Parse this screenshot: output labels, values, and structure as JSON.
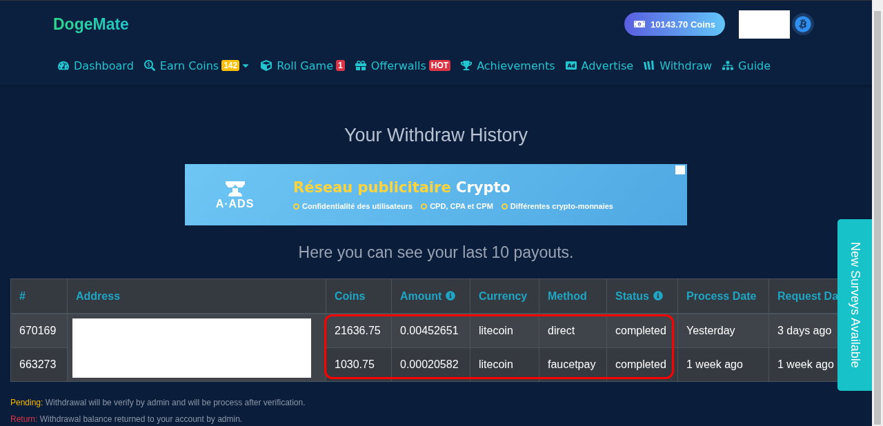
{
  "brand": "DogeMate",
  "balance": "10143.70 Coins",
  "nav": [
    {
      "kind": "dashboard",
      "label": "Dashboard"
    },
    {
      "kind": "earn",
      "label": "Earn Coins",
      "badge": {
        "text": "142",
        "color": "#ffc107"
      },
      "dropdown": true
    },
    {
      "kind": "roll",
      "label": "Roll Game",
      "badge": {
        "text": "1",
        "color": "#dc3545"
      }
    },
    {
      "kind": "offerwalls",
      "label": "Offerwalls",
      "badge": {
        "text": "HOT",
        "color": "#dc3545"
      }
    },
    {
      "kind": "achievements",
      "label": "Achievements"
    },
    {
      "kind": "advertise",
      "label": "Advertise"
    },
    {
      "kind": "withdraw",
      "label": "Withdraw"
    },
    {
      "kind": "guide",
      "label": "Guide"
    }
  ],
  "page_title": "Your Withdraw History",
  "ad_banner": {
    "brand": "A·ADS",
    "headline_highlight": "Réseau publicitaire",
    "headline_rest": "Crypto",
    "features": [
      "Confidentialité des utilisateurs",
      "CPD, CPA et CPM",
      "Différentes crypto-monnaies"
    ]
  },
  "subtitle": "Here you can see your last 10 payouts.",
  "table": {
    "columns": [
      {
        "label": "#",
        "info": false
      },
      {
        "label": "Address",
        "info": false
      },
      {
        "label": "Coins",
        "info": false
      },
      {
        "label": "Amount",
        "info": true
      },
      {
        "label": "Currency",
        "info": false
      },
      {
        "label": "Method",
        "info": false
      },
      {
        "label": "Status",
        "info": true
      },
      {
        "label": "Process Date",
        "info": false
      },
      {
        "label": "Request Da",
        "info": false
      }
    ],
    "rows": [
      [
        "670169",
        "",
        "21636.75",
        "0.00452651",
        "litecoin",
        "direct",
        "completed",
        "Yesterday",
        "3 days ago"
      ],
      [
        "663273",
        "",
        "1030.75",
        "0.00020582",
        "litecoin",
        "faucetpay",
        "completed",
        "1 week ago",
        "1 week ago"
      ]
    ]
  },
  "legend": [
    {
      "term": "Pending:",
      "color": "#f5b800",
      "text": "Withdrawal will be verify by admin and will be process after verification."
    },
    {
      "term": "Return:",
      "color": "#dc3545",
      "text": "Withdrawal balance returned to your account by admin."
    }
  ],
  "side_tab": "New Surveys Available"
}
